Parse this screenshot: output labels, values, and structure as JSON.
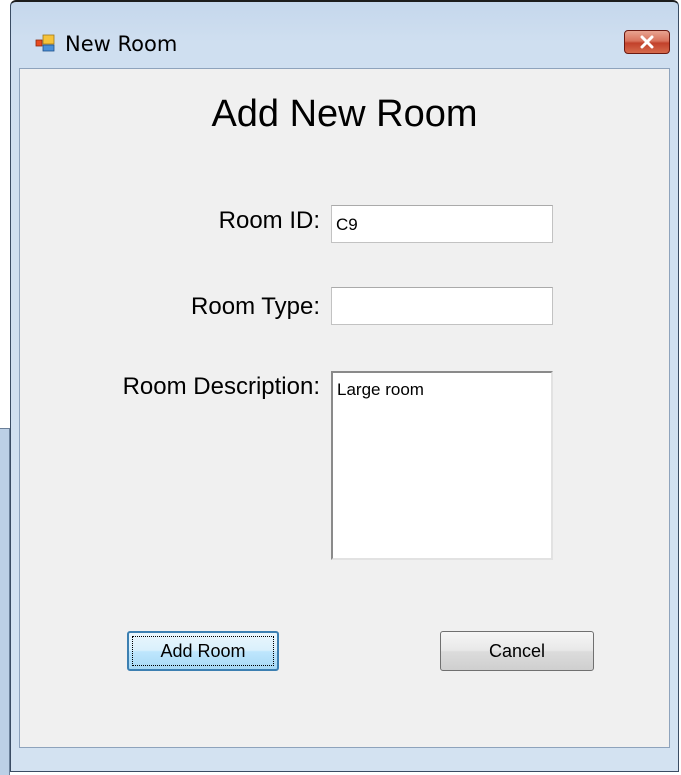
{
  "window": {
    "title": "New Room"
  },
  "form": {
    "heading": "Add New Room",
    "room_id_label": "Room ID:",
    "room_id_value": "C9",
    "room_type_label": "Room Type:",
    "room_type_value": "",
    "room_description_label": "Room Description:",
    "room_description_value": "Large room"
  },
  "buttons": {
    "add_room": "Add Room",
    "cancel": "Cancel"
  },
  "icons": {
    "app": "form-window-icon",
    "close": "close-x-icon"
  },
  "colors": {
    "titlebar": "#c5d7ec",
    "close_button": "#c2412b",
    "client_background": "#f0f0f0",
    "default_button_border": "#3c7fb1"
  }
}
